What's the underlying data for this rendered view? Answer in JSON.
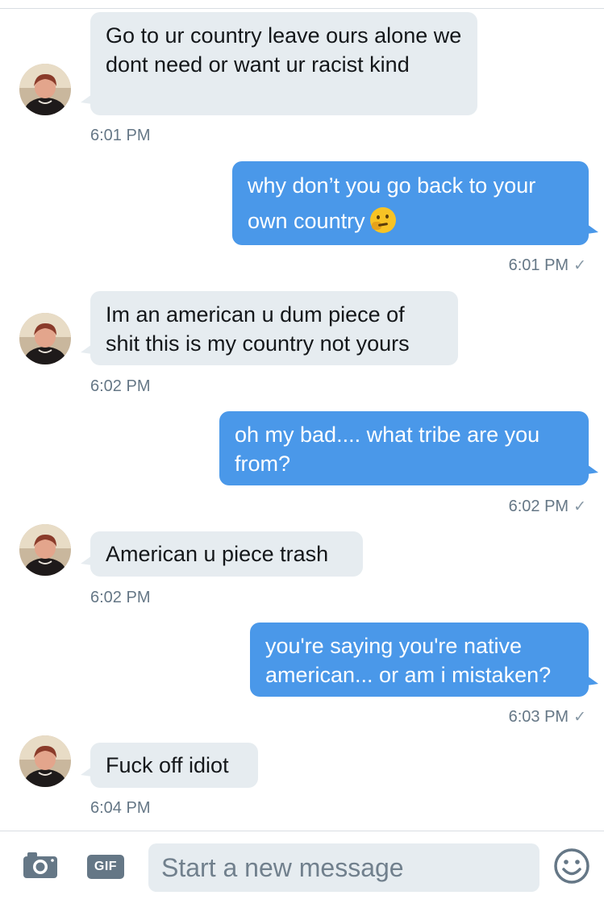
{
  "messages": [
    {
      "dir": "in",
      "text": "Go to ur country leave ours alone we dont need or want ur racist kind",
      "time": "6:01 PM"
    },
    {
      "dir": "out",
      "text": "why don’t you go back to your own country",
      "emoji": "thinking-face",
      "time": "6:01 PM"
    },
    {
      "dir": "in",
      "text": "Im an american u dum piece of shit this is my country not yours",
      "time": "6:02 PM"
    },
    {
      "dir": "out",
      "text": "oh my bad.... what tribe are you from?",
      "time": "6:02 PM"
    },
    {
      "dir": "in",
      "text": "American u piece trash",
      "time": "6:02 PM"
    },
    {
      "dir": "out",
      "text": "you're saying you're native american... or am i mistaken?",
      "time": "6:03 PM"
    },
    {
      "dir": "in",
      "text": "Fuck off idiot",
      "time": "6:04 PM"
    }
  ],
  "read_receipt": "✓",
  "composer": {
    "placeholder": "Start a new message",
    "gif_label": "GIF",
    "camera_icon": "camera-icon",
    "emoji_icon": "smiley-icon"
  },
  "colors": {
    "outgoing": "#4a98e9",
    "incoming": "#e6ecf0",
    "meta": "#657786"
  }
}
